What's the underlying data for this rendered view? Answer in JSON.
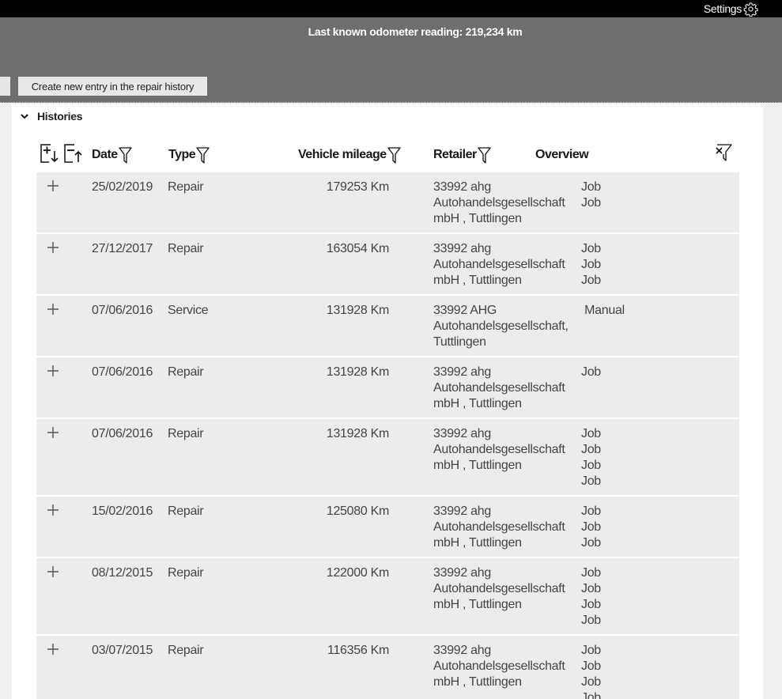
{
  "topbar": {
    "settings_label": "Settings"
  },
  "header": {
    "odometer": "Last known odometer reading: 219,234 km",
    "create_button": "Create new entry in the repair history"
  },
  "section": {
    "title": "Histories"
  },
  "columns": {
    "date": "Date",
    "type": "Type",
    "mileage": "Vehicle mileage",
    "retailer": "Retailer",
    "overview": "Overview"
  },
  "rows": [
    {
      "date": "25/02/2019",
      "type": "Repair",
      "mileage": "179253 Km",
      "retailer": [
        "33992 ahg",
        "Autohandelsgesellschaft",
        "mbH , Tuttlingen"
      ],
      "overview": [
        "Job",
        "Job"
      ]
    },
    {
      "date": "27/12/2017",
      "type": "Repair",
      "mileage": "163054 Km",
      "retailer": [
        "33992 ahg",
        "Autohandelsgesellschaft",
        "mbH , Tuttlingen"
      ],
      "overview": [
        "Job",
        "Job",
        "Job"
      ]
    },
    {
      "date": "07/06/2016",
      "type": "Service",
      "mileage": "131928 Km",
      "retailer": [
        "33992 AHG",
        "Autohandelsgesellschaft,",
        "Tuttlingen"
      ],
      "overview": [
        " Manual"
      ]
    },
    {
      "date": "07/06/2016",
      "type": "Repair",
      "mileage": "131928 Km",
      "retailer": [
        "33992 ahg",
        "Autohandelsgesellschaft",
        "mbH , Tuttlingen"
      ],
      "overview": [
        "Job"
      ]
    },
    {
      "date": "07/06/2016",
      "type": "Repair",
      "mileage": "131928 Km",
      "retailer": [
        "33992 ahg",
        "Autohandelsgesellschaft",
        "mbH , Tuttlingen"
      ],
      "overview": [
        "Job",
        "Job",
        "Job",
        "Job"
      ]
    },
    {
      "date": "15/02/2016",
      "type": "Repair",
      "mileage": "125080 Km",
      "retailer": [
        "33992 ahg",
        "Autohandelsgesellschaft",
        "mbH , Tuttlingen"
      ],
      "overview": [
        "Job",
        "Job",
        "Job"
      ]
    },
    {
      "date": "08/12/2015",
      "type": "Repair",
      "mileage": "122000 Km",
      "retailer": [
        "33992 ahg",
        "Autohandelsgesellschaft",
        "mbH , Tuttlingen"
      ],
      "overview": [
        "Job",
        "Job",
        "Job",
        "Job"
      ]
    },
    {
      "date": "03/07/2015",
      "type": "Repair",
      "mileage": "116356 Km",
      "retailer": [
        "33992 ahg",
        "Autohandelsgesellschaft",
        "mbH , Tuttlingen"
      ],
      "overview": [
        "Job",
        "Job",
        "Job",
        "Job"
      ]
    }
  ]
}
